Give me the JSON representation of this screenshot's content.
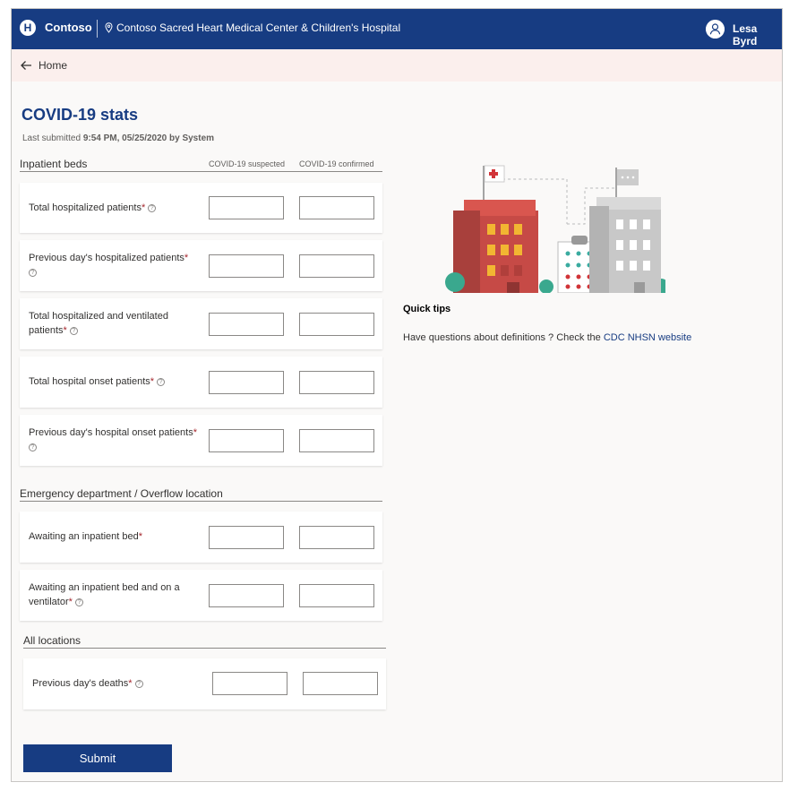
{
  "header": {
    "logo_letter": "H",
    "brand": "Contoso",
    "location": "Contoso Sacred Heart Medical Center & Children's Hospital",
    "user_name": "Lesa Byrd"
  },
  "nav": {
    "home_label": "Home"
  },
  "page": {
    "title": "COVID-19 stats",
    "last_submitted_prefix": "Last submitted",
    "last_submitted_value": "9:54 PM, 05/25/2020 by System"
  },
  "columns": {
    "suspected": "COVID-19 suspected",
    "confirmed": "COVID-19 confirmed"
  },
  "sections": {
    "inpatient": {
      "title": "Inpatient beds",
      "rows": [
        {
          "label": "Total hospitalized patients",
          "required": "*",
          "help": "?"
        },
        {
          "label": "Previous day's hospitalized patients",
          "required": "*",
          "help": "?"
        },
        {
          "label": "Total hospitalized and ventilated patients",
          "required": "*",
          "help": "?"
        },
        {
          "label": "Total hospital onset patients",
          "required": "*",
          "help": "?"
        },
        {
          "label": "Previous day's hospital onset patients",
          "required": "*",
          "help": "?"
        }
      ]
    },
    "emergency": {
      "title": "Emergency department / Overflow location",
      "rows": [
        {
          "label": "Awaiting an inpatient bed",
          "required": "*"
        },
        {
          "label": "Awaiting an inpatient bed and on a ventilator",
          "required": "*",
          "help": "?"
        }
      ]
    },
    "all": {
      "title": "All locations",
      "rows": [
        {
          "label": "Previous day's deaths",
          "required": "*",
          "help": "?"
        }
      ]
    }
  },
  "tips": {
    "title": "Quick tips",
    "text": "Have questions about definitions ? Check the ",
    "link": "CDC NHSN website"
  },
  "submit_label": "Submit",
  "colors": {
    "primary": "#173c82",
    "required": "#a4262c",
    "home_bar": "#fbefed"
  }
}
